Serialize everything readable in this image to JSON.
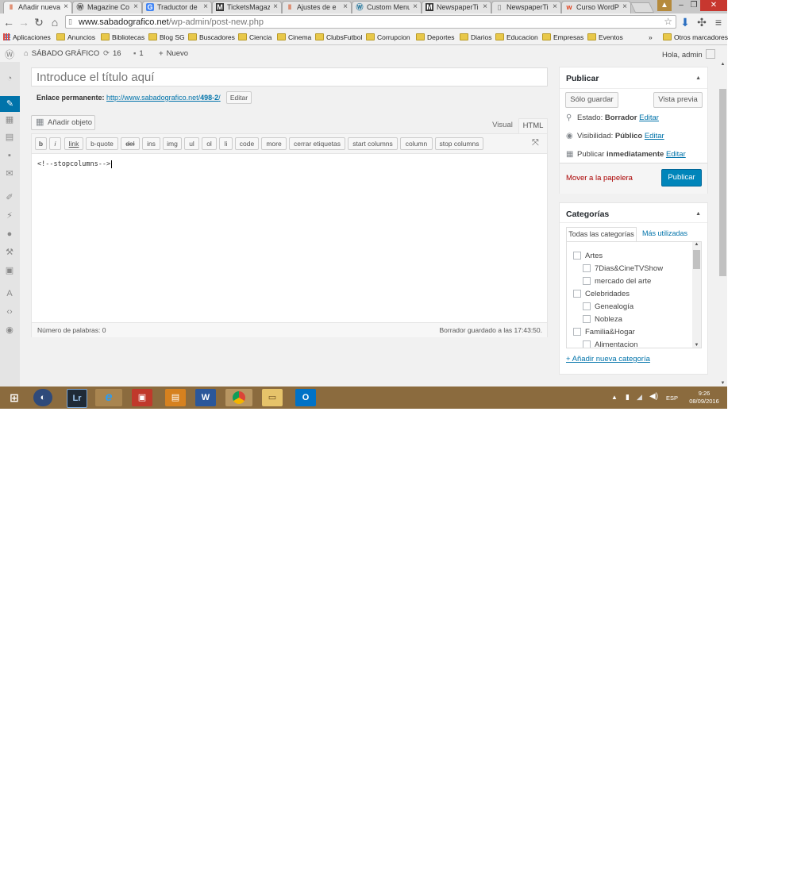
{
  "browser": {
    "tabs": [
      {
        "label": "Añadir nueva",
        "icon": "wp-icon",
        "active": true
      },
      {
        "label": "Magazine Co",
        "icon": "wordpress-icon"
      },
      {
        "label": "Traductor de",
        "icon": "translate-icon"
      },
      {
        "label": "TicketsMagaz",
        "icon": "m-icon"
      },
      {
        "label": "Ajustes de e",
        "icon": "wp-icon"
      },
      {
        "label": "Custom Menu",
        "icon": "wordpress-icon"
      },
      {
        "label": "NewspaperTi",
        "icon": "m-icon"
      },
      {
        "label": "NewspaperTi",
        "icon": "doc-icon"
      },
      {
        "label": "Curso WordP",
        "icon": "w-icon"
      }
    ],
    "url_host": "www.sabadografico.net",
    "url_path": "/wp-admin/post-new.php",
    "bookmarks": [
      "Aplicaciones",
      "Anuncios",
      "Bibliotecas",
      "Blog SG",
      "Buscadores",
      "Ciencia",
      "Cinema",
      "ClubsFutbol",
      "Corrupcion",
      "Deportes",
      "Diarios",
      "Educacion",
      "Empresas",
      "Eventos"
    ],
    "bookmarks_more": "»",
    "other_bookmarks": "Otros marcadores"
  },
  "adminbar": {
    "site_name": "SÁBADO GRÁFICO",
    "updates": "16",
    "comments": "1",
    "new_label": "Nuevo",
    "greeting": "Hola, admin"
  },
  "editor": {
    "title_placeholder": "Introduce el título aquí",
    "permalink_label": "Enlace permanente:",
    "permalink_base": "http://www.sabadografico.net/",
    "permalink_slug": "498-2",
    "permalink_trail": "/",
    "edit_slug_button": "Editar",
    "add_media_label": "Añadir objeto",
    "tab_visual": "Visual",
    "tab_html": "HTML",
    "quicktags": [
      "b",
      "i",
      "link",
      "b-quote",
      "del",
      "ins",
      "img",
      "ul",
      "ol",
      "li",
      "code",
      "more",
      "cerrar etiquetas",
      "start columns",
      "column",
      "stop columns"
    ],
    "content": "<!--stopcolumns-->",
    "word_count": "Número de palabras: 0",
    "draft_saved": "Borrador guardado a las 17:43:50."
  },
  "publish_box": {
    "title": "Publicar",
    "save_draft": "Sólo guardar",
    "preview": "Vista previa",
    "status_label": "Estado:",
    "status_value": "Borrador",
    "visibility_label": "Visibilidad:",
    "visibility_value": "Público",
    "publish_label": "Publicar",
    "publish_value": "inmediatamente",
    "edit_link": "Editar",
    "trash_link": "Mover a la papelera",
    "publish_button": "Publicar"
  },
  "categories_box": {
    "title": "Categorías",
    "tab_all": "Todas las categorías",
    "tab_popular": "Más utilizadas",
    "items": [
      {
        "label": "Artes",
        "level": 0
      },
      {
        "label": "7Dias&CineTVShow",
        "level": 1
      },
      {
        "label": "mercado del arte",
        "level": 1
      },
      {
        "label": "Celebridades",
        "level": 0
      },
      {
        "label": "Genealogía",
        "level": 1
      },
      {
        "label": "Nobleza",
        "level": 1
      },
      {
        "label": "Familia&Hogar",
        "level": 0
      },
      {
        "label": "Alimentacion",
        "level": 1
      }
    ],
    "add_new_link": "+ Añadir nueva categoría"
  },
  "taskbar": {
    "apps": [
      "start-icon",
      "explorer-icon",
      "lightroom-icon",
      "internet-explorer-icon",
      "game-icon",
      "app-icon",
      "word-icon",
      "chrome-icon",
      "folder-icon",
      "outlook-icon"
    ],
    "lightroom_label": "Lr",
    "word_label": "W",
    "outlook_label": "O",
    "language": "ESP",
    "time": "9:26",
    "date": "08/09/2016"
  },
  "colors": {
    "wp_blue": "#0073aa",
    "publish_button": "#0085ba",
    "trash_red": "#a00",
    "taskbar": "#8b6b3e"
  }
}
